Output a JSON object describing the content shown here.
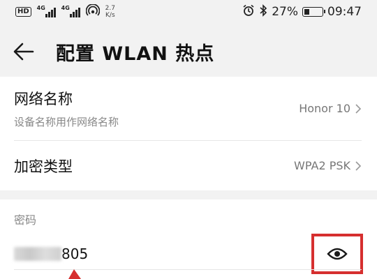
{
  "status_bar": {
    "left": {
      "hd": "HD",
      "sim1": "4G",
      "sim2": "4G",
      "speed_value": "2.7",
      "speed_unit": "K/s"
    },
    "right": {
      "battery": "27%",
      "time": "09:47"
    },
    "icons": [
      "hd-icon",
      "signal-icon",
      "signal-icon",
      "hotspot-icon",
      "alarm-icon",
      "bluetooth-icon",
      "battery-icon"
    ]
  },
  "header": {
    "title": "配置 WLAN 热点"
  },
  "settings": {
    "network_name": {
      "label": "网络名称",
      "description": "设备名称用作网络名称",
      "value": "Honor 10"
    },
    "encryption": {
      "label": "加密类型",
      "value": "WPA2 PSK"
    },
    "password": {
      "label": "密码",
      "visible_suffix": "805"
    }
  },
  "colors": {
    "highlight": "#d62f2f",
    "background": "#f2f2f2",
    "card": "#ffffff"
  }
}
